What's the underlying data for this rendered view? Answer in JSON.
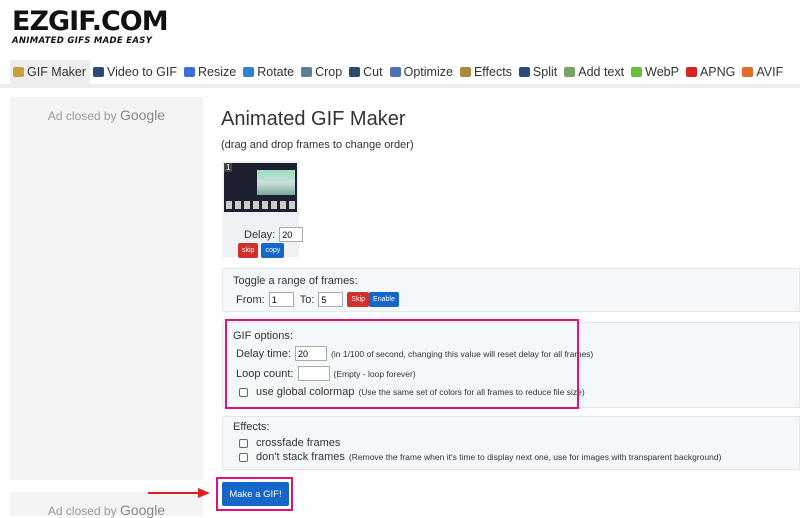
{
  "logo": {
    "title": "EZGIF.COM",
    "tagline": "ANIMATED GIFS MADE EASY"
  },
  "nav": [
    {
      "label": "GIF Maker",
      "icon": "gif-maker-icon",
      "color": "#c9a13b"
    },
    {
      "label": "Video to GIF",
      "icon": "film-icon",
      "color": "#2b4a7a"
    },
    {
      "label": "Resize",
      "icon": "resize-icon",
      "color": "#3a6fd8"
    },
    {
      "label": "Rotate",
      "icon": "rotate-icon",
      "color": "#2f86d0"
    },
    {
      "label": "Crop",
      "icon": "crop-icon",
      "color": "#5b7f8f"
    },
    {
      "label": "Cut",
      "icon": "cut-icon",
      "color": "#2d4a6d"
    },
    {
      "label": "Optimize",
      "icon": "optimize-icon",
      "color": "#4a73b0"
    },
    {
      "label": "Effects",
      "icon": "effects-icon",
      "color": "#b08a3c"
    },
    {
      "label": "Split",
      "icon": "split-icon",
      "color": "#2c4c7c"
    },
    {
      "label": "Add text",
      "icon": "add-text-icon",
      "color": "#7aa36a"
    },
    {
      "label": "WebP",
      "icon": "webp-icon",
      "color": "#6cbf3c"
    },
    {
      "label": "APNG",
      "icon": "apng-icon",
      "color": "#d82222"
    },
    {
      "label": "AVIF",
      "icon": "avif-icon",
      "color": "#e36b2a"
    }
  ],
  "ads": {
    "text": "Ad closed by",
    "brand": "Google"
  },
  "main": {
    "title": "Animated GIF Maker",
    "hint": "(drag and drop frames to change order)",
    "frame": {
      "number": "1",
      "delay_label": "Delay:",
      "delay_value": "20",
      "skip": "skip",
      "copy": "copy"
    },
    "toggle": {
      "title": "Toggle a range of frames:",
      "from_label": "From:",
      "from_value": "1",
      "to_label": "To:",
      "to_value": "5",
      "skip": "Skip",
      "enable": "Enable"
    },
    "gif_options": {
      "title": "GIF options:",
      "delay_label": "Delay time:",
      "delay_value": "20",
      "delay_note": "(in 1/100 of second, changing this value will reset delay for all frames)",
      "loop_label": "Loop count:",
      "loop_value": "",
      "loop_note": "(Empty - loop forever)",
      "colormap_label": "use global colormap",
      "colormap_note": "(Use the same set of colors for all frames to reduce file size)"
    },
    "effects": {
      "title": "Effects:",
      "crossfade_label": "crossfade frames",
      "nostack_label": "don't stack frames",
      "nostack_note": "(Remove the frame when it's time to display next one, use for images with transparent background)"
    },
    "make_button": "Make a GIF!"
  },
  "colors": {
    "highlight": "#e0117f",
    "arrow": "#e02020",
    "primary": "#1466c8",
    "danger": "#d0312d"
  }
}
